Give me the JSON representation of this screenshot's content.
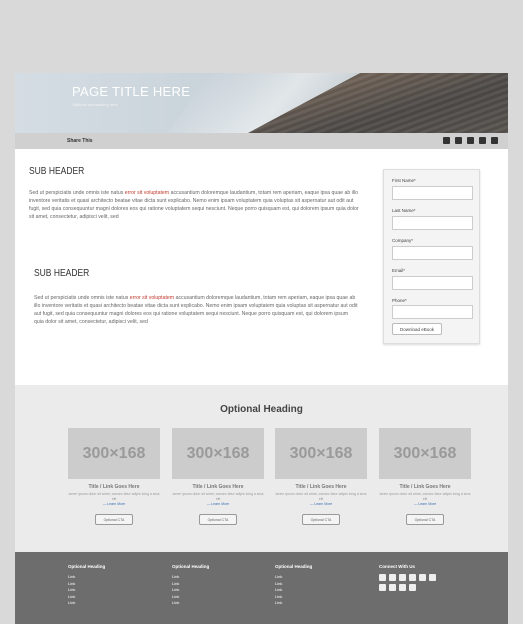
{
  "hero": {
    "title": "PAGE TITLE HERE",
    "subtitle": "Optional subheading here"
  },
  "share": {
    "label": "Share This",
    "icons": [
      "facebook-icon",
      "linkedin-icon",
      "email-icon",
      "print-icon",
      "more-icon"
    ]
  },
  "main": {
    "sections": [
      {
        "header": "SUB HEADER",
        "text_before": "Sed ut perspiciatis unde omnis iste natus ",
        "link": "error sit voluptatem",
        "text_after": " accusantium doloremque laudantium, totam rem aperiam, eaque ipsa quae ab illo inventore veritatis et quasi architecto beatae vitae dicta sunt explicabo. Nemo enim ipsam voluptatem quia voluptas sit aspernatur aut odit aut fugit, sed quia consequuntur magni dolores eos qui ratione voluptatem sequi nesciunt. Neque porro quisquam est, qui dolorem ipsum quia dolor sit amet, consectetur, adipisci velit, sed"
      },
      {
        "header": "SUB HEADER",
        "text_before": "Sed ut perspiciatis unde omnis iste natus ",
        "link": "error sit voluptatem",
        "text_after": " accusantium doloremque laudantium, totam rem aperiam, eaque ipsa quae ab illo inventore veritatis et quasi architecto beatae vitae dicta sunt explicabo. Nemo enim ipsam voluptatem quia voluptas sit aspernatur aut odit aut fugit, sed quia consequuntur magni dolores eos qui ratione voluptatem sequi nesciunt. Neque porro quisquam est, qui dolorem ipsum quia dolor sit amet, consectetur, adipisci velit, sed"
      }
    ]
  },
  "form": {
    "fields": [
      {
        "label": "First Name*",
        "value": ""
      },
      {
        "label": "Last Name*",
        "value": ""
      },
      {
        "label": "Company*",
        "value": ""
      },
      {
        "label": "Email*",
        "value": ""
      },
      {
        "label": "Phone*",
        "value": ""
      }
    ],
    "button": "Download eBook"
  },
  "optional": {
    "heading": "Optional Heading",
    "cards": [
      {
        "thumb": "300×168",
        "title": "Title / Link Goes Here",
        "desc": "lorem ipsum dolor sit amet, consec tetur adipis icing a sma elit",
        "link": "— Learn More",
        "cta": "Optional CTA"
      },
      {
        "thumb": "300×168",
        "title": "Title / Link Goes Here",
        "desc": "lorem ipsum dolor sit amet, consec tetur adipis icing a sma elit",
        "link": "— Learn More",
        "cta": "Optional CTA"
      },
      {
        "thumb": "300×168",
        "title": "Title / Link Goes Here",
        "desc": "lorem ipsum dolor sit amet, consec tetur adipis icing a sma elit",
        "link": "— Learn More",
        "cta": "Optional CTA"
      },
      {
        "thumb": "300×168",
        "title": "Title / Link Goes Here",
        "desc": "lorem ipsum dolor sit amet, consec tetur adipis icing a sma elit",
        "link": "— Learn More",
        "cta": "Optional CTA"
      }
    ]
  },
  "footer": {
    "columns": [
      {
        "heading": "Optional Heading",
        "links": [
          "Link",
          "Link",
          "Link",
          "Link",
          "Link"
        ]
      },
      {
        "heading": "Optional Heading",
        "links": [
          "Link",
          "Link",
          "Link",
          "Link",
          "Link"
        ]
      },
      {
        "heading": "Optional Heading",
        "links": [
          "Link",
          "Link",
          "Link",
          "Link",
          "Link"
        ]
      }
    ],
    "connect_heading": "Connect With Us",
    "social_icons": [
      "facebook-icon",
      "twitter-icon",
      "youtube-icon",
      "linkedin-icon",
      "rss-icon",
      "google-plus-icon",
      "skype-icon",
      "flickr-icon",
      "instagram-icon",
      "pinterest-icon"
    ]
  }
}
